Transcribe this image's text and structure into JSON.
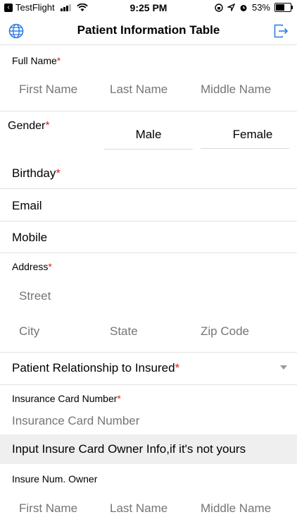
{
  "status_bar": {
    "back_app": "TestFlight",
    "time": "9:25 PM",
    "battery": "53%",
    "battery_level": 0.53
  },
  "header": {
    "title": "Patient Information Table"
  },
  "form": {
    "full_name": {
      "label": "Full Name",
      "required": "*",
      "first_placeholder": "First Name",
      "last_placeholder": "Last Name",
      "middle_placeholder": "Middle Name"
    },
    "gender": {
      "label": "Gender",
      "required": "*",
      "options": [
        "Male",
        "Female"
      ]
    },
    "birthday": {
      "label": "Birthday",
      "required": "*"
    },
    "email": {
      "label": "Email"
    },
    "mobile": {
      "label": "Mobile"
    },
    "address": {
      "label": "Address",
      "required": "*",
      "street_placeholder": "Street",
      "city_placeholder": "City",
      "state_placeholder": "State",
      "zip_placeholder": "Zip Code"
    },
    "relationship": {
      "label": "Patient Relationship to Insured",
      "required": "*"
    },
    "insurance_card": {
      "label": "Insurance Card Number",
      "required": "*",
      "placeholder": "Insurance Card Number"
    },
    "owner_banner": "Input Insure Card Owner Info,if it's not yours",
    "owner": {
      "label": "Insure Num. Owner",
      "first_placeholder": "First Name",
      "last_placeholder": "Last Name",
      "middle_placeholder": "Middle Name"
    }
  }
}
